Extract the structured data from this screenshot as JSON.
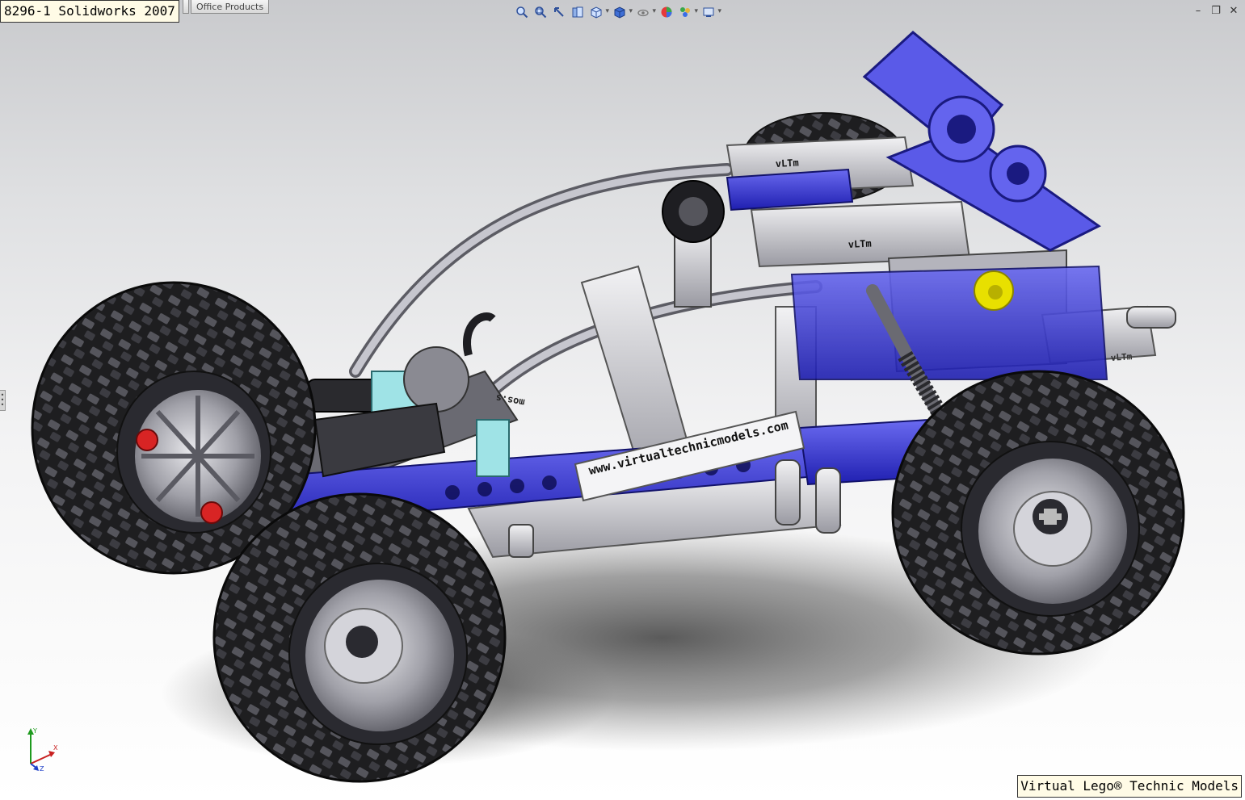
{
  "document": {
    "title": "8296-1 Solidworks 2007",
    "tabs": [
      {
        "label": "Office Products"
      }
    ]
  },
  "heads_up_toolbar": [
    {
      "icon": "zoom-to-fit-icon"
    },
    {
      "icon": "zoom-to-area-icon"
    },
    {
      "icon": "previous-view-icon"
    },
    {
      "icon": "section-view-icon"
    },
    {
      "icon": "view-orientation-icon"
    },
    {
      "icon": "display-style-icon"
    },
    {
      "icon": "hide-show-items-icon"
    },
    {
      "icon": "edit-appearance-icon"
    },
    {
      "icon": "apply-scene-icon"
    },
    {
      "icon": "view-settings-icon"
    }
  ],
  "window_controls": [
    {
      "icon": "minimize-icon",
      "glyph": "–"
    },
    {
      "icon": "restore-icon",
      "glyph": "❐"
    },
    {
      "icon": "close-icon",
      "glyph": "✕"
    }
  ],
  "model": {
    "stickers": {
      "website": "www.virtualtechnicmodels.com",
      "website_mirror": "mos.s",
      "brand": "vLTm"
    }
  },
  "triad": {
    "x_label": "X",
    "y_label": "Y",
    "z_label": "Z"
  },
  "colors": {
    "chassis_blue": "#3c3cd6",
    "tire_black": "#202022",
    "beam_gray": "#c8c8cc",
    "pin_red": "#d82424",
    "gear_yellow": "#e8e000",
    "axle_teal": "#9fe3e6"
  },
  "footer": {
    "label": "Virtual Lego® Technic Models"
  }
}
